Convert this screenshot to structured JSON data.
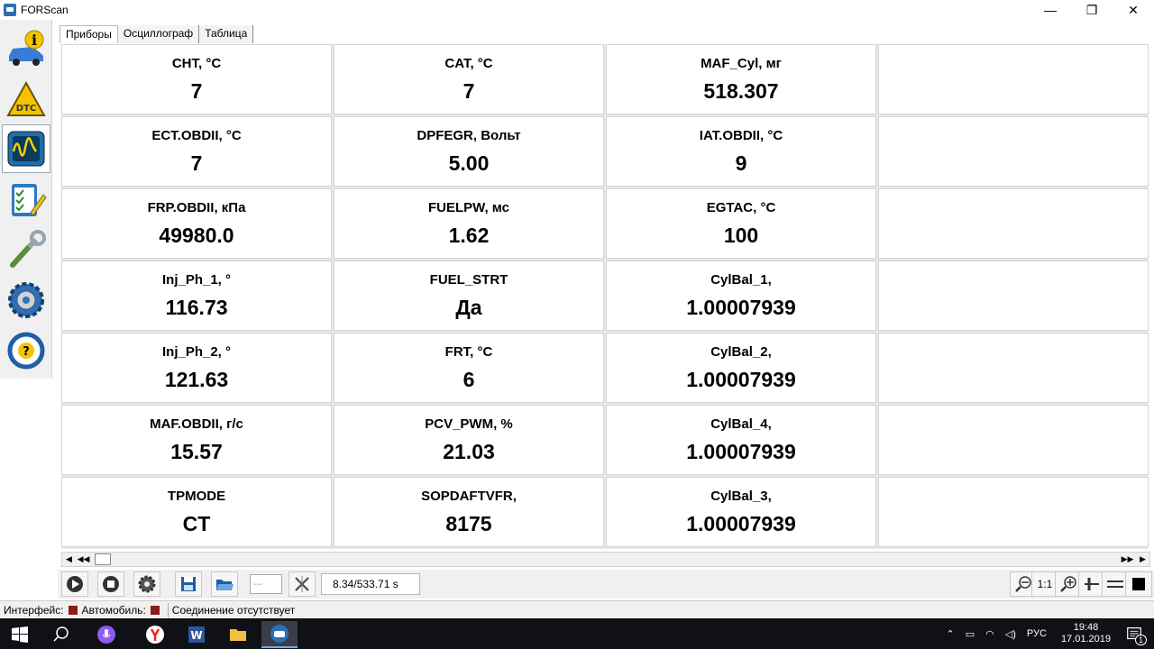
{
  "window": {
    "title": "FORScan",
    "min": "—",
    "restore": "❐",
    "close": "✕"
  },
  "tabs": [
    "Приборы",
    "Осциллограф",
    "Таблица"
  ],
  "sidebar_icons": [
    "info-car-icon",
    "dtc-warning-icon",
    "oscilloscope-icon",
    "checklist-icon",
    "wrench-icon",
    "gear-config-icon",
    "help-steering-icon"
  ],
  "gauges": [
    [
      {
        "label": "CHT, °C",
        "value": "7"
      },
      {
        "label": "CAT, °C",
        "value": "7"
      },
      {
        "label": "MAF_Cyl, мг",
        "value": "518.307"
      },
      {
        "label": "",
        "value": ""
      }
    ],
    [
      {
        "label": "ECT.OBDII, °C",
        "value": "7"
      },
      {
        "label": "DPFEGR, Вольт",
        "value": "5.00"
      },
      {
        "label": "IAT.OBDII, °C",
        "value": "9"
      },
      {
        "label": "",
        "value": ""
      }
    ],
    [
      {
        "label": "FRP.OBDII, кПа",
        "value": "49980.0"
      },
      {
        "label": "FUELPW, мс",
        "value": "1.62"
      },
      {
        "label": "EGTAC, °C",
        "value": "100"
      },
      {
        "label": "",
        "value": ""
      }
    ],
    [
      {
        "label": "Inj_Ph_1, °",
        "value": "116.73"
      },
      {
        "label": "FUEL_STRT",
        "value": "Да"
      },
      {
        "label": "CylBal_1,",
        "value": "1.00007939"
      },
      {
        "label": "",
        "value": ""
      }
    ],
    [
      {
        "label": "Inj_Ph_2, °",
        "value": "121.63"
      },
      {
        "label": "FRT, °C",
        "value": "6"
      },
      {
        "label": "CylBal_2,",
        "value": "1.00007939"
      },
      {
        "label": "",
        "value": ""
      }
    ],
    [
      {
        "label": "MAF.OBDII, г/с",
        "value": "15.57"
      },
      {
        "label": "PCV_PWM, %",
        "value": "21.03"
      },
      {
        "label": "CylBal_4,",
        "value": "1.00007939"
      },
      {
        "label": "",
        "value": ""
      }
    ],
    [
      {
        "label": "TPMODE",
        "value": "CT"
      },
      {
        "label": "SOPDAFTVFR,",
        "value": "8175"
      },
      {
        "label": "CylBal_3,",
        "value": "1.00007939"
      },
      {
        "label": "",
        "value": ""
      }
    ]
  ],
  "toolbar": {
    "time_readout": "8.34/533.71 s",
    "combo_value": "---",
    "zoom_ratio": "1:1"
  },
  "statusbar": {
    "interface_label": "Интерфейс:",
    "vehicle_label": "Автомобиль:",
    "connection_text": "Соединение отсутствует",
    "status_color": "#8b1a1a"
  },
  "taskbar": {
    "language": "РУС",
    "time": "19:48",
    "date": "17.01.2019",
    "notification_count": "1"
  }
}
